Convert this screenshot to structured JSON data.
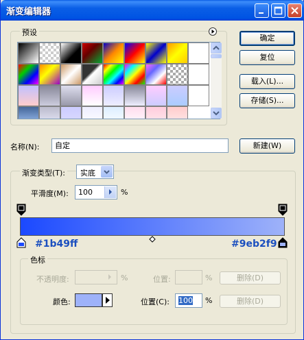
{
  "window": {
    "title": "渐变编辑器"
  },
  "presets": {
    "legend": "预设",
    "menu_icon": "circle-arrow-icon"
  },
  "buttons": {
    "ok": "确定",
    "reset": "复位",
    "load": "载入(L)...",
    "save": "存储(S)...",
    "new": "新建(W)",
    "delete1": "删除(D)",
    "delete2": "删除(D)"
  },
  "name": {
    "label": "名称(N):",
    "value": "自定"
  },
  "gradient_type": {
    "legend_label": "渐变类型(T):",
    "selected": "实底"
  },
  "smoothness": {
    "label": "平滑度(M):",
    "value": "100",
    "unit": "%"
  },
  "stops": {
    "left_hex": "#1b49ff",
    "right_hex": "#9eb2f9"
  },
  "color_stop": {
    "legend": "色标",
    "opacity_label": "不透明度:",
    "opacity_unit": "%",
    "location_label_disabled": "位置:",
    "location_unit_disabled": "%",
    "color_label": "颜色:",
    "location_label": "位置(C):",
    "location_value": "100",
    "location_unit": "%"
  },
  "colors": {
    "start": "#1b49ff",
    "end": "#9eb2f9",
    "swatch_color": "#9eb2f9"
  }
}
